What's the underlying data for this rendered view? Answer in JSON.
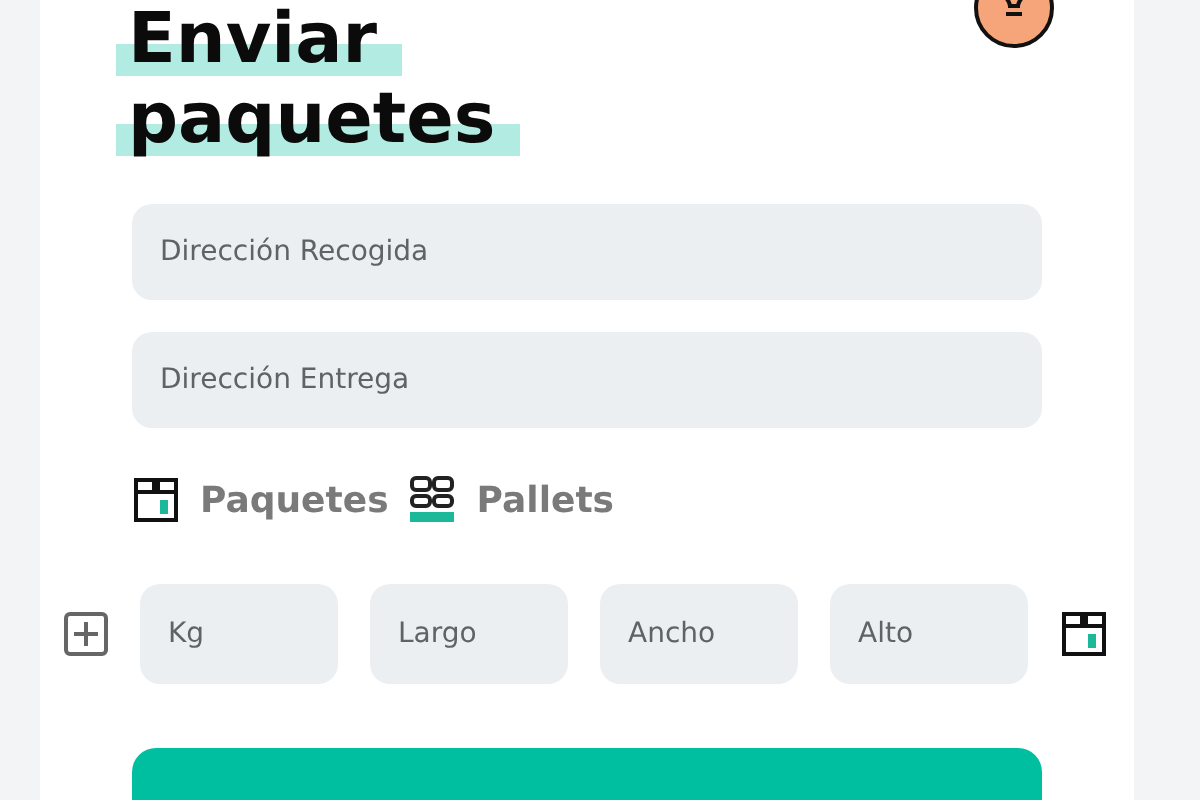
{
  "title_lines": [
    "Enviar",
    "paquetes"
  ],
  "address_fields": [
    {
      "placeholder": "Dirección Recogida"
    },
    {
      "placeholder": "Dirección Entrega"
    }
  ],
  "package_types": [
    {
      "label": "Paquetes",
      "kind": "box"
    },
    {
      "label": "Pallets",
      "kind": "pallet"
    }
  ],
  "dimension_fields": [
    {
      "placeholder": "Kg"
    },
    {
      "placeholder": "Largo"
    },
    {
      "placeholder": "Ancho"
    },
    {
      "placeholder": "Alto"
    }
  ]
}
